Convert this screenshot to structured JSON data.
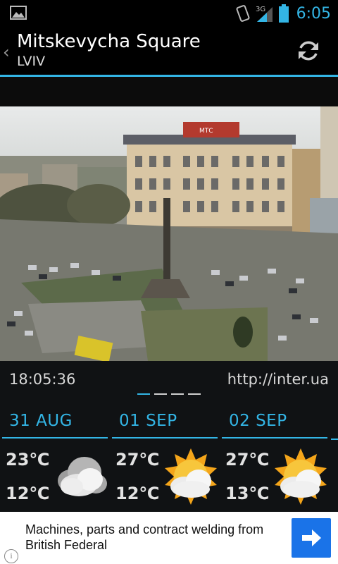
{
  "status_bar": {
    "time": "6:05",
    "network": "3G",
    "icons": [
      "image-icon",
      "vibrate-icon",
      "signal-icon",
      "battery-icon"
    ]
  },
  "header": {
    "title": "Mitskevycha Square",
    "subtitle": "LVIV",
    "refresh_icon": "refresh-icon"
  },
  "camera": {
    "overlay_text": "МТС"
  },
  "info": {
    "time": "18:05:36",
    "link": "http://inter.ua"
  },
  "forecast": [
    {
      "date": "31 AUG",
      "high": "23℃",
      "low": "12℃",
      "icon": "cloudy-icon"
    },
    {
      "date": "01 SEP",
      "high": "27℃",
      "low": "12℃",
      "icon": "partly-sunny-icon"
    },
    {
      "date": "02 SEP",
      "high": "27℃",
      "low": "13℃",
      "icon": "partly-sunny-icon"
    }
  ],
  "ad": {
    "text": "Machines, parts and contract welding from British Federal",
    "info_label": "i"
  },
  "colors": {
    "accent": "#33b5e5",
    "background": "#101214",
    "ad_button": "#1a73e8"
  }
}
